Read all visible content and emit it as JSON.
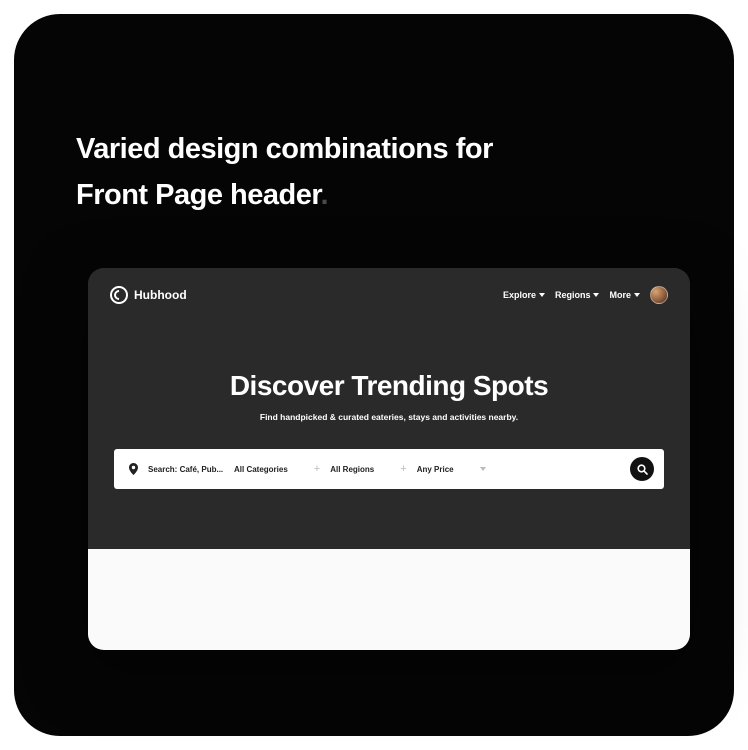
{
  "headline": {
    "line1": "Varied design combinations for",
    "line2": "Front Page header",
    "dot": "."
  },
  "brand": {
    "name": "Hubhood"
  },
  "nav": {
    "items": [
      "Explore",
      "Regions",
      "More"
    ]
  },
  "hero": {
    "title": "Discover Trending Spots",
    "subtitle": "Find handpicked & curated eateries, stays and activities nearby."
  },
  "search": {
    "placeholder": "Search: Café, Pub...",
    "filters": {
      "categories": "All Categories",
      "regions": "All Regions",
      "price": "Any Price"
    }
  }
}
